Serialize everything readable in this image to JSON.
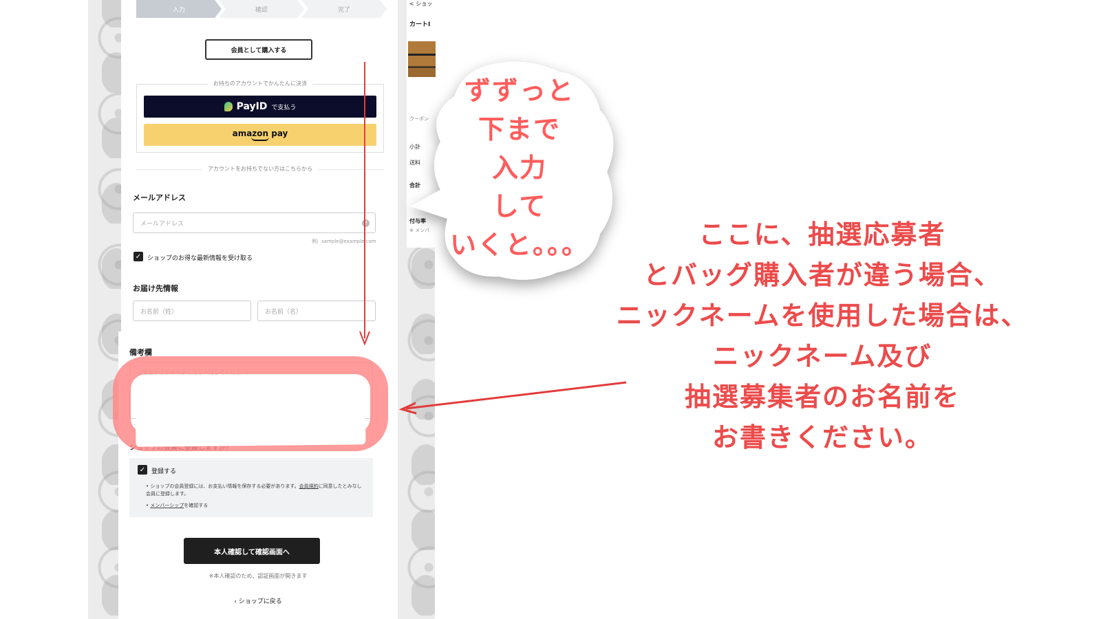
{
  "stepper": {
    "steps": [
      "入力",
      "確認",
      "完了"
    ]
  },
  "member_button": "会員として購入する",
  "quickpay": {
    "legend": "お持ちのアカウントでかんたんに決済",
    "payid_word": "PayID",
    "payid_suffix": "で支払う",
    "amazon_label": "amazon pay"
  },
  "divider": "アカウントをお持ちでない方はこちらから",
  "email": {
    "label": "メールアドレス",
    "placeholder": "メールアドレス",
    "hint": "例）sample@example.com",
    "help": "?"
  },
  "newsletter": {
    "checkmark": "✓",
    "label": "ショップのお得な最新情報を受け取る"
  },
  "shipping": {
    "label": "お届け先情報",
    "last_name_placeholder": "お名前（姓）",
    "first_name_placeholder": "お名前（名）"
  },
  "remarks": {
    "label": "備考欄",
    "placeholder": "ご要望などがありましたら入力してください。"
  },
  "registration": {
    "question": "ショップの会員に登録しますか？",
    "checkmark": "✓",
    "check_label": "登録する",
    "note1_a": "ショップの会員登録には、お支払い情報を保存する必要があります。",
    "note1_link": "会員規約",
    "note1_b": "に同意したとみなし会員に登録します。",
    "note2_link": "メンバーシップ",
    "note2_b": "を確認する"
  },
  "submit": "本人確認して確認画面へ",
  "submit_note": "※本人確認のため、認証画面が開きます",
  "back": "‹ ショップに戻る",
  "summary": {
    "back": "< ショッ",
    "cart": "カートI",
    "coupon": "クーポン",
    "subtotal": "小計",
    "shipping": "送料",
    "total": "合計",
    "points": "付与率",
    "member": "※ メンバ"
  },
  "bubble": [
    "ずずっと",
    "下まで",
    "入力",
    "して",
    "いくと。。。"
  ],
  "annotation": [
    "ここに、抽選応募者",
    "とバッグ購入者が違う場合、",
    "ニックネームを使用した場合は、",
    "ニックネーム及び",
    "抽選募集者のお名前を",
    "お書きください。"
  ],
  "colors": {
    "accent": "#ec4b4b",
    "highlight": "#ff8a8a",
    "payid_bg": "#0c0d2b",
    "amazon_bg": "#f8d16f"
  }
}
